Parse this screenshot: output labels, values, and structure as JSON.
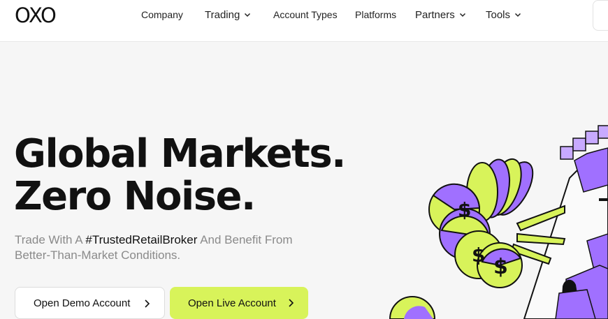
{
  "header": {
    "logo": "OXO",
    "nav": [
      {
        "label": "Company",
        "dropdown": false
      },
      {
        "label": "Trading",
        "dropdown": true
      },
      {
        "label": "Account Types",
        "dropdown": false
      },
      {
        "label": "Platforms",
        "dropdown": false
      },
      {
        "label": "Partners",
        "dropdown": true
      },
      {
        "label": "Tools",
        "dropdown": true
      }
    ]
  },
  "hero": {
    "title_line1": "Global Markets.",
    "title_line2": "Zero Noise.",
    "subtitle_pre": "Trade With A ",
    "subtitle_highlight": "#TrustedRetailBroker",
    "subtitle_post": " And Benefit From Better-Than-Market Conditions."
  },
  "buttons": {
    "demo": "Open Demo Account",
    "live": "Open Live Account"
  },
  "colors": {
    "accent": "#d8f35a",
    "purple": "#a070ff",
    "text": "#111111",
    "muted": "#8a8a8a"
  },
  "icons": [
    "chevron-down-icon",
    "chevron-right-icon",
    "dollar-sign-icon"
  ]
}
